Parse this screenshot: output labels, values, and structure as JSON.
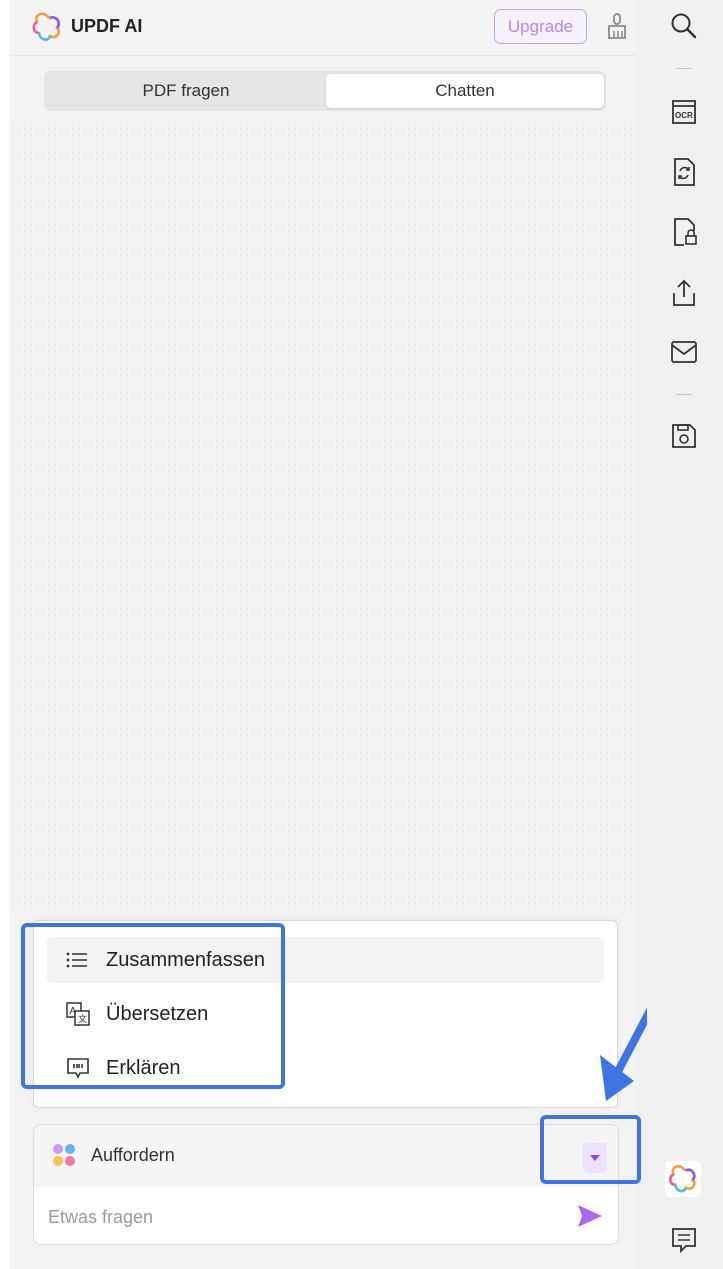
{
  "header": {
    "app_title": "UPDF AI",
    "upgrade_label": "Upgrade"
  },
  "tabs": [
    {
      "label": "PDF fragen",
      "active": false
    },
    {
      "label": "Chatten",
      "active": true
    }
  ],
  "prompt_menu": {
    "items": [
      {
        "label": "Zusammenfassen",
        "icon": "list-icon",
        "hovered": true
      },
      {
        "label": "Übersetzen",
        "icon": "translate-icon",
        "hovered": false
      },
      {
        "label": "Erklären",
        "icon": "explain-icon",
        "hovered": false
      }
    ]
  },
  "input": {
    "prompt_label": "Auffordern",
    "placeholder": "Etwas fragen"
  },
  "rail": {
    "icons": [
      "search-icon",
      "ocr-icon",
      "convert-icon",
      "protect-icon",
      "share-icon",
      "mail-icon",
      "save-icon",
      "updf-ai-icon",
      "comment-icon"
    ]
  },
  "colors": {
    "accent": "#a36cf0",
    "highlight": "#3f74e3"
  }
}
